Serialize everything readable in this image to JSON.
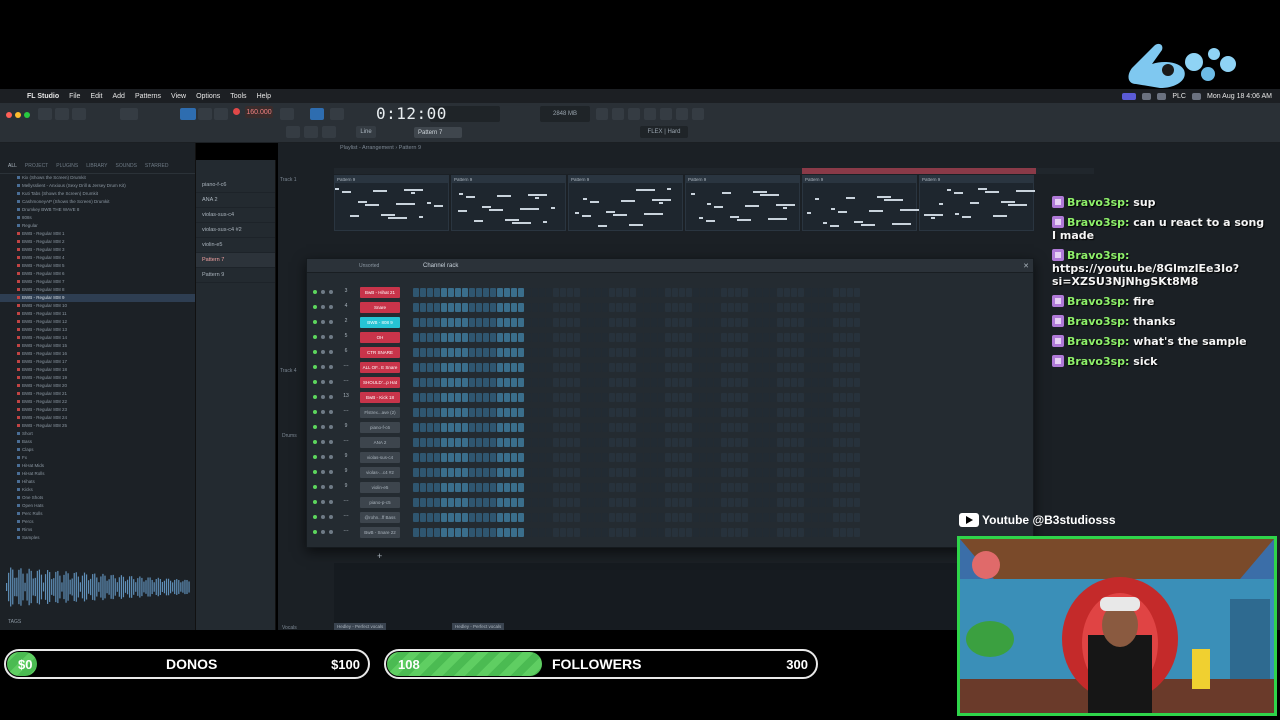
{
  "menubar": {
    "app": "FL Studio",
    "items": [
      "File",
      "Edit",
      "Add",
      "Patterns",
      "View",
      "Options",
      "Tools",
      "Help"
    ],
    "tray_text": "PLC",
    "clock": "Mon Aug 18  4:06 AM"
  },
  "toolbar": {
    "tempo": "160.000",
    "time": "0:12:00",
    "pattern": "Pattern 7",
    "snap": "Line",
    "memory": "2848 MB",
    "preset": "FLEX | Hard"
  },
  "browser": {
    "tabs": [
      "ALL",
      "PROJECT",
      "PLUGINS",
      "LIBRARY",
      "SOUNDS",
      "STARRED"
    ],
    "items": [
      {
        "label": "Kix (Shows the Screen) Drumkit",
        "type": "folder"
      },
      {
        "label": "Mellysslient - Anxious (Sexy Drill & Jersey Drum Kit)",
        "type": "folder"
      },
      {
        "label": "Kuti Tabs (Shows the Screen) Drumkit",
        "type": "folder"
      },
      {
        "label": "CashmoneyAP (Shows the Screen) Drumkit",
        "type": "folder"
      },
      {
        "label": "Drumkey BWB THE WAVE 8",
        "type": "folder"
      },
      {
        "label": "808s",
        "type": "folder"
      },
      {
        "label": "Regular",
        "type": "folder"
      },
      {
        "label": "BWB - Regular 808 1",
        "type": "file"
      },
      {
        "label": "BWB - Regular 808 2",
        "type": "file"
      },
      {
        "label": "BWB - Regular 808 3",
        "type": "file"
      },
      {
        "label": "BWB - Regular 808 4",
        "type": "file"
      },
      {
        "label": "BWB - Regular 808 5",
        "type": "file"
      },
      {
        "label": "BWB - Regular 808 6",
        "type": "file"
      },
      {
        "label": "BWB - Regular 808 7",
        "type": "file"
      },
      {
        "label": "BWB - Regular 808 8",
        "type": "file"
      },
      {
        "label": "BWB - Regular 808 9",
        "type": "file",
        "selected": true
      },
      {
        "label": "BWB - Regular 808 10",
        "type": "file"
      },
      {
        "label": "BWB - Regular 808 11",
        "type": "file"
      },
      {
        "label": "BWB - Regular 808 12",
        "type": "file"
      },
      {
        "label": "BWB - Regular 808 13",
        "type": "file"
      },
      {
        "label": "BWB - Regular 808 14",
        "type": "file"
      },
      {
        "label": "BWB - Regular 808 15",
        "type": "file"
      },
      {
        "label": "BWB - Regular 808 16",
        "type": "file"
      },
      {
        "label": "BWB - Regular 808 17",
        "type": "file"
      },
      {
        "label": "BWB - Regular 808 18",
        "type": "file"
      },
      {
        "label": "BWB - Regular 808 19",
        "type": "file"
      },
      {
        "label": "BWB - Regular 808 20",
        "type": "file"
      },
      {
        "label": "BWB - Regular 808 21",
        "type": "file"
      },
      {
        "label": "BWB - Regular 808 22",
        "type": "file"
      },
      {
        "label": "BWB - Regular 808 23",
        "type": "file"
      },
      {
        "label": "BWB - Regular 808 24",
        "type": "file"
      },
      {
        "label": "BWB - Regular 808 25",
        "type": "file"
      },
      {
        "label": "Short",
        "type": "folder"
      },
      {
        "label": "Bass",
        "type": "folder"
      },
      {
        "label": "Claps",
        "type": "folder"
      },
      {
        "label": "Fx",
        "type": "folder"
      },
      {
        "label": "HiHat Mids",
        "type": "folder"
      },
      {
        "label": "HiHat Rolls",
        "type": "folder"
      },
      {
        "label": "Hihats",
        "type": "folder"
      },
      {
        "label": "Kicks",
        "type": "folder"
      },
      {
        "label": "One Shots",
        "type": "folder"
      },
      {
        "label": "Open Hats",
        "type": "folder"
      },
      {
        "label": "Perc Rolls",
        "type": "folder"
      },
      {
        "label": "Percs",
        "type": "folder"
      },
      {
        "label": "Rims",
        "type": "folder"
      },
      {
        "label": "Samples",
        "type": "folder"
      }
    ],
    "tags_label": "TAGS"
  },
  "patterns": [
    "piano-f-c6",
    "ANA 2",
    "violas-sus-c4",
    "violas-sus-c4 #2",
    "violin-e5",
    "Pattern 7",
    "Pattern 9"
  ],
  "playlist": {
    "title": "Playlist - Arrangement › Pattern 9",
    "tracks": [
      "Track 1",
      "Track 4",
      "Drums",
      "Vocals"
    ],
    "clip_label": "Pattern 9",
    "clip_count": 6,
    "vocal_clip": "Hedley - Perfect vocals"
  },
  "channel_rack": {
    "title": "Channel rack",
    "sort": "Unsorted",
    "channels": [
      {
        "num": "3",
        "name": "BwB - Hihat 21",
        "color": "#c8344a",
        "steps": 16
      },
      {
        "num": "4",
        "name": "Snare",
        "color": "#c8344a",
        "steps": 16
      },
      {
        "num": "2",
        "name": "BWB - 808 9",
        "color": "#26c4d4",
        "steps": 16
      },
      {
        "num": "5",
        "name": "OH",
        "color": "#c8344a",
        "steps": 16
      },
      {
        "num": "6",
        "name": "CTR SNARE",
        "color": "#c8344a",
        "steps": 16
      },
      {
        "num": "---",
        "name": "ALL OF.. E Snare",
        "color": "#c8344a",
        "steps": 16
      },
      {
        "num": "---",
        "name": "SHOULD'...p Hat",
        "color": "#c8344a",
        "steps": 16
      },
      {
        "num": "13",
        "name": "BwB - Kick 18",
        "color": "#c8344a",
        "steps": 16
      },
      {
        "num": "---",
        "name": "Flstrex...ave (2)",
        "color": "#3d454d",
        "steps": 16
      },
      {
        "num": "9",
        "name": "piano-f-c6",
        "color": "#3d454d",
        "steps": 16
      },
      {
        "num": "---",
        "name": "ANA 2",
        "color": "#3d454d",
        "steps": 16
      },
      {
        "num": "9",
        "name": "violas-sus-c4",
        "color": "#3d454d",
        "steps": 16
      },
      {
        "num": "9",
        "name": "violas-...c4 #2",
        "color": "#3d454d",
        "steps": 16
      },
      {
        "num": "9",
        "name": "violin-e5",
        "color": "#3d454d",
        "steps": 16
      },
      {
        "num": "---",
        "name": "piano-p-c5",
        "color": "#3d454d",
        "steps": 16
      },
      {
        "num": "---",
        "name": "@rohn...ff Bass",
        "color": "#3d454d",
        "steps": 16
      },
      {
        "num": "---",
        "name": "BwB - Snare 22",
        "color": "#3d454d",
        "steps": 16
      }
    ]
  },
  "chat": [
    {
      "user": "Bravo3sp:",
      "text": "sup"
    },
    {
      "user": "Bravo3sp:",
      "text": "can u react to a song I made"
    },
    {
      "user": "Bravo3sp:",
      "text": "https://youtu.be/8GlmzlEe3Io?si=XZSU3NjNhgSKt8M8"
    },
    {
      "user": "Bravo3sp:",
      "text": "fire"
    },
    {
      "user": "Bravo3sp:",
      "text": "thanks"
    },
    {
      "user": "Bravo3sp:",
      "text": "what's the sample"
    },
    {
      "user": "Bravo3sp:",
      "text": "sick"
    }
  ],
  "youtube": {
    "handle": "Youtube @B3studiosss",
    "icon": "youtube-icon"
  },
  "goals": {
    "donos": {
      "current": "$0",
      "label": "DONOS",
      "target": "$100",
      "progress": 0.0
    },
    "followers": {
      "current": "108",
      "label": "FOLLOWERS",
      "target": "300",
      "progress": 0.36
    }
  },
  "colors": {
    "accent_green": "#5fce62",
    "cam_border": "#2fd44a",
    "chat_user": "#8ef06a",
    "red_channel": "#c8344a",
    "cyan_channel": "#26c4d4"
  }
}
